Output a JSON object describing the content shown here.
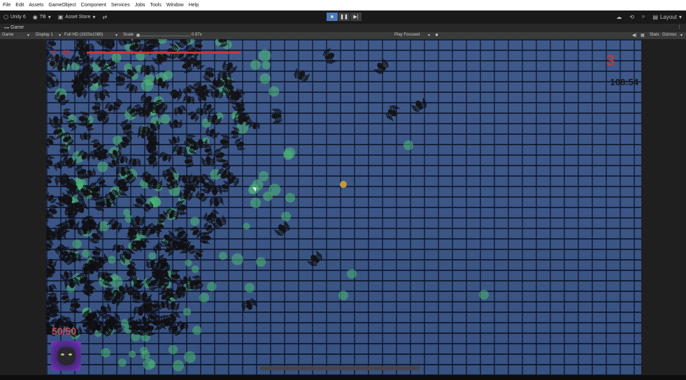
{
  "menu": [
    "File",
    "Edit",
    "Assets",
    "GameObject",
    "Component",
    "Services",
    "Jobs",
    "Tools",
    "Window",
    "Help"
  ],
  "toolbar": {
    "unity_label": "Unity 6",
    "account_label": "TB",
    "asset_store_label": "Asset Store",
    "layout_label": "Layout"
  },
  "tab": {
    "label": "Game"
  },
  "gamebar": {
    "mode": "Game",
    "display": "Display 1",
    "resolution": "Full HD (1920x1080)",
    "scale_label": "Scale",
    "scale_value": "0.97x",
    "play_focused": "Play Focused",
    "stats": "Stats",
    "gizmos": "Gizmos"
  },
  "hud": {
    "hp_value": "99",
    "wave": "3",
    "timer": "108:54",
    "ammo": "50/50"
  },
  "colors": {
    "accent": "#4a78b8",
    "hp": "#d32f2f",
    "orb": "#4fbf7a",
    "floor": "#3b5688"
  }
}
